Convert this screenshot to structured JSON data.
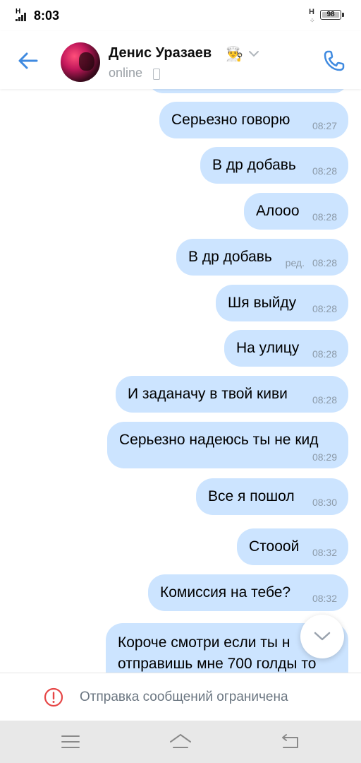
{
  "status_bar": {
    "network_left": "H",
    "time": "8:03",
    "network_right": "H",
    "battery": "98"
  },
  "header": {
    "contact_name": "Денис Уразаев",
    "emoji": "👨‍🍳",
    "status": "online",
    "icons": [
      "arrow-left-icon",
      "avatar",
      "chevron-down-icon",
      "mobile-icon",
      "phone-icon"
    ],
    "accent_color": "#3f8ae0"
  },
  "messages": [
    {
      "text": "Серьезно говорю",
      "time": "08:27",
      "edited": ""
    },
    {
      "text": "В др добавь",
      "time": "08:28",
      "edited": ""
    },
    {
      "text": "Алооо",
      "time": "08:28",
      "edited": ""
    },
    {
      "text": "В др добавь",
      "time": "08:28",
      "edited": "ред."
    },
    {
      "text": "Шя выйду",
      "time": "08:28",
      "edited": ""
    },
    {
      "text": "На улицу",
      "time": "08:28",
      "edited": ""
    },
    {
      "text": "И заданачу в твой киви",
      "time": "08:28",
      "edited": ""
    },
    {
      "text": "Серьезно надеюсь ты не кид",
      "time": "08:29",
      "edited": ""
    },
    {
      "text": "Все я пошол",
      "time": "08:30",
      "edited": ""
    },
    {
      "text": "Стооой",
      "time": "08:32",
      "edited": ""
    },
    {
      "text": "Комиссия на тебе?",
      "time": "08:32",
      "edited": ""
    },
    {
      "text_line1": "Короче смотри если ты н",
      "text_line2": "отправишь мне 700 голды то"
    }
  ],
  "bubble_color": "#cce4ff",
  "restriction": {
    "text": "Отправка сообщений ограничена",
    "icon": "exclamation-circle-icon",
    "icon_color": "#e64646"
  },
  "navbar": {
    "icons": [
      "menu-icon",
      "home-icon",
      "back-icon"
    ]
  }
}
